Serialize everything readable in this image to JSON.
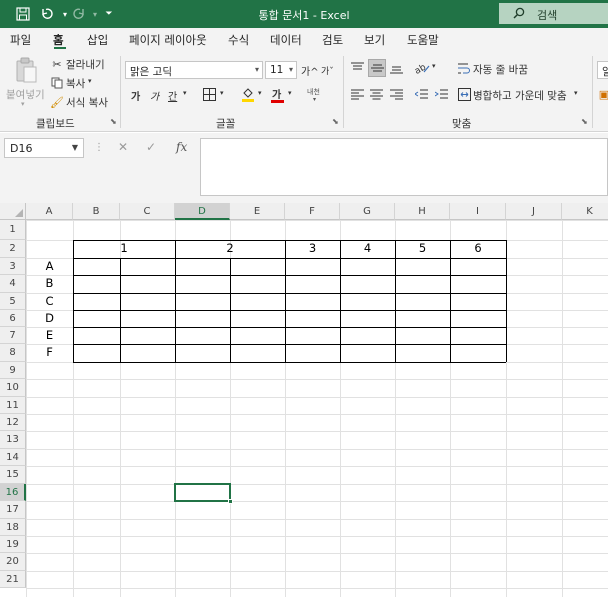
{
  "titlebar": {
    "title": "통합 문서1  -  Excel",
    "search_label": "검색",
    "icons": [
      "save-icon",
      "undo-icon",
      "redo-icon",
      "customize-icon"
    ]
  },
  "menu": {
    "tabs": [
      "파일",
      "홈",
      "삽입",
      "페이지 레이아웃",
      "수식",
      "데이터",
      "검토",
      "보기",
      "도움말"
    ],
    "active": "홈"
  },
  "ribbon": {
    "clipboard": {
      "paste": "붙여넣기",
      "cut": "잘라내기",
      "copy": "복사",
      "format_painter": "서식 복사",
      "label": "클립보드"
    },
    "font": {
      "font_name": "맑은 고딕",
      "font_size": "11",
      "grow": "가^",
      "shrink": "가ˇ",
      "bold": "가",
      "italic": "가",
      "underline": "간",
      "font_color": "가",
      "phonetic": "내천",
      "label": "글꼴"
    },
    "alignment": {
      "wrap_text": "자동 줄 바꿈",
      "merge_center": "병합하고 가운데 맞춤",
      "label": "맞춤"
    },
    "cut_off": "일"
  },
  "formula_bar": {
    "name_box": "D16",
    "cancel": "✕",
    "enter": "✓",
    "fx": "fx",
    "value": ""
  },
  "sheet": {
    "columns": [
      "A",
      "B",
      "C",
      "D",
      "E",
      "F",
      "G",
      "H",
      "I",
      "J",
      "K"
    ],
    "selected_column": "D",
    "rows": [
      "1",
      "2",
      "3",
      "4",
      "5",
      "6",
      "7",
      "8",
      "9",
      "10",
      "11",
      "12",
      "13",
      "14",
      "15",
      "16",
      "17",
      "18",
      "19",
      "20",
      "21"
    ],
    "selected_row": "16",
    "header_row_values": [
      "1",
      "2",
      "3",
      "4",
      "5",
      "6"
    ],
    "row_labels": [
      "A",
      "B",
      "C",
      "D",
      "E",
      "F"
    ],
    "active_cell": "D16"
  },
  "colors": {
    "excel_green": "#217346",
    "title_bar": "#217346",
    "ribbon_bg": "#f3f3f3",
    "gridline": "#e1e1e1",
    "table_border": "#000000"
  }
}
